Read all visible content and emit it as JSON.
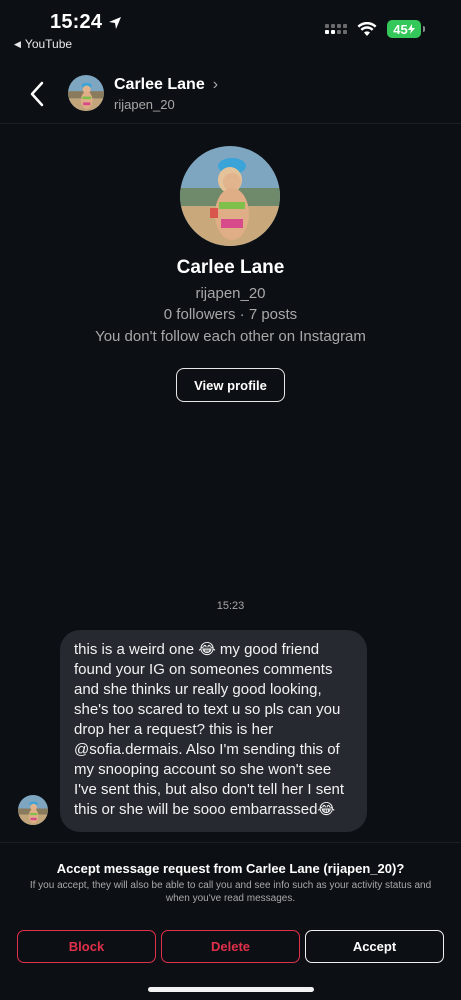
{
  "status_bar": {
    "time": "15:24",
    "back_app": "YouTube",
    "battery": "45"
  },
  "header": {
    "name": "Carlee Lane",
    "username": "rijapen_20",
    "chevron": "›"
  },
  "profile": {
    "name": "Carlee Lane",
    "username": "rijapen_20",
    "stats": "0 followers · 7 posts",
    "follow_status": "You don't follow each other on Instagram",
    "view_profile_label": "View profile"
  },
  "messages": {
    "timestamp": "15:23",
    "text": "this is a weird one 😂 my good friend found your IG on someones comments and she thinks ur really good looking, she's too scared to text u so pls can you drop her a request? this is her @sofia.dermais. Also I'm sending this of my snooping account so she won't see I've sent this, but also don't tell her I sent this or she will be sooo embarrassed😂"
  },
  "request": {
    "title": "Accept message request from Carlee Lane (rijapen_20)?",
    "description": "If you accept, they will also be able to call you and see info such as your activity status and when you've read messages.",
    "block_label": "Block",
    "delete_label": "Delete",
    "accept_label": "Accept"
  },
  "colors": {
    "background": "#0c0f14",
    "bubble": "#262930",
    "danger": "#e0304a",
    "battery": "#34c759"
  },
  "icons": [
    "location-arrow-icon",
    "signal-icon",
    "wifi-icon",
    "battery-icon",
    "back-chevron-icon"
  ]
}
